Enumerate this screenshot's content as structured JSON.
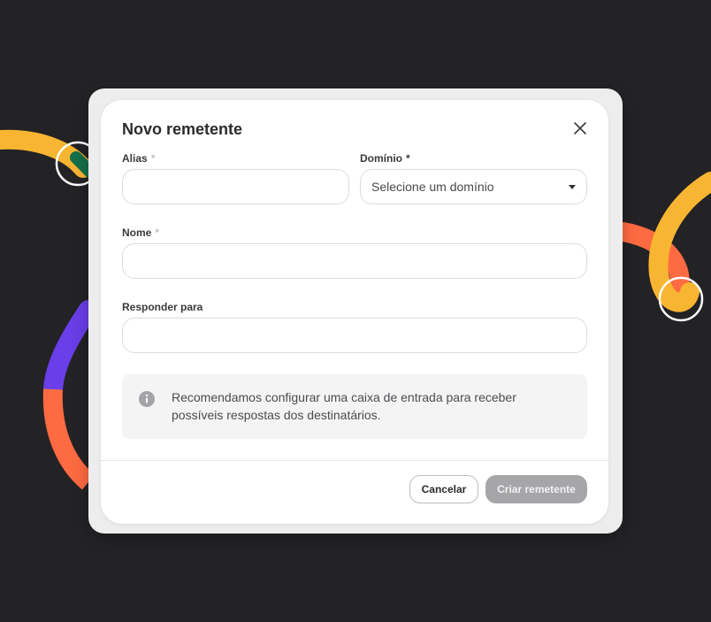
{
  "modal": {
    "title": "Novo remetente",
    "close_icon": "close-icon"
  },
  "fields": {
    "alias": {
      "label": "Alias",
      "required_mark": "*",
      "value": ""
    },
    "domain": {
      "label": "Domínio",
      "required_mark": "*",
      "selected": "Selecione um domínio"
    },
    "name": {
      "label": "Nome",
      "required_mark": "*",
      "value": ""
    },
    "reply_to": {
      "label": "Responder para",
      "value": ""
    }
  },
  "info": {
    "icon": "info-icon",
    "text": "Recomendamos configurar uma caixa de entrada para receber possíveis respostas dos destinatários."
  },
  "footer": {
    "cancel_label": "Cancelar",
    "create_label": "Criar remetente"
  },
  "colors": {
    "background": "#232225",
    "create_disabled": "#a6a6a9",
    "decor_yellow": "#f8b531",
    "decor_orange": "#fe6b42",
    "decor_purple": "#6a3ee8",
    "decor_green": "#147049"
  }
}
